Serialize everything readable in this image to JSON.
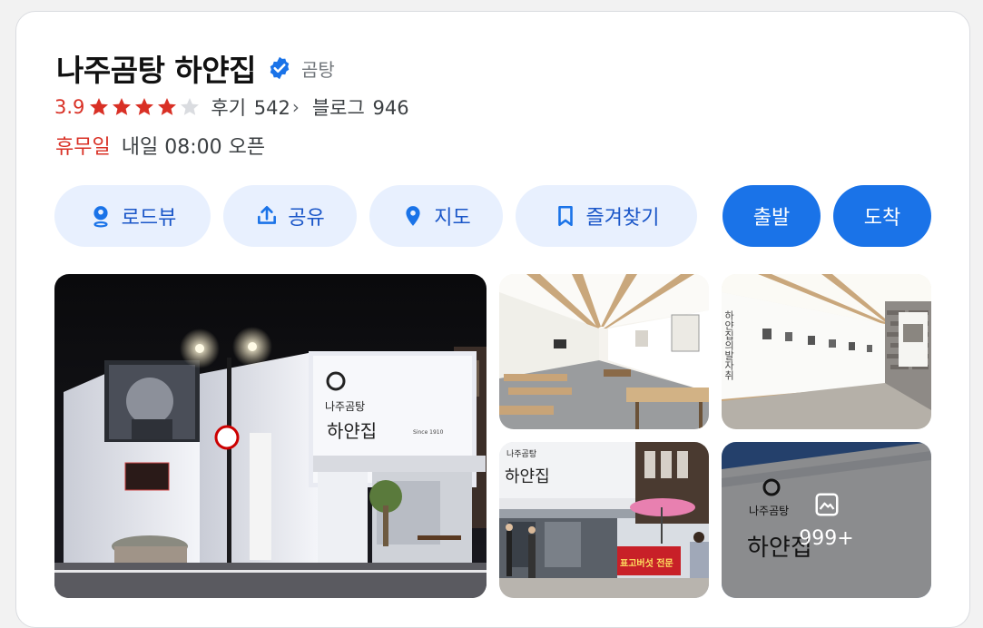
{
  "place": {
    "name": "나주곰탕 하얀집",
    "category": "곰탕",
    "rating": "3.9",
    "star_count": 4,
    "reviews_label": "후기",
    "reviews_count": "542",
    "blog_label": "블로그",
    "blog_count": "946",
    "status": "휴무일",
    "hours": "내일 08:00 오픈"
  },
  "actions": {
    "roadview": "로드뷰",
    "share": "공유",
    "map": "지도",
    "save": "즐겨찾기",
    "depart": "출발",
    "arrive": "도착"
  },
  "photos": {
    "more_count": "999+",
    "sign_brand": "나주곰탕",
    "sign_name": "하얀집",
    "sign_since": "Since 1910",
    "wall_text": "하얀집의발자취",
    "red_banner": "표고버섯 전문"
  },
  "colors": {
    "accent": "#1a73e8",
    "light_button": "#e8f0fe",
    "rating_red": "#d93025",
    "star_gray": "#dadce0"
  }
}
